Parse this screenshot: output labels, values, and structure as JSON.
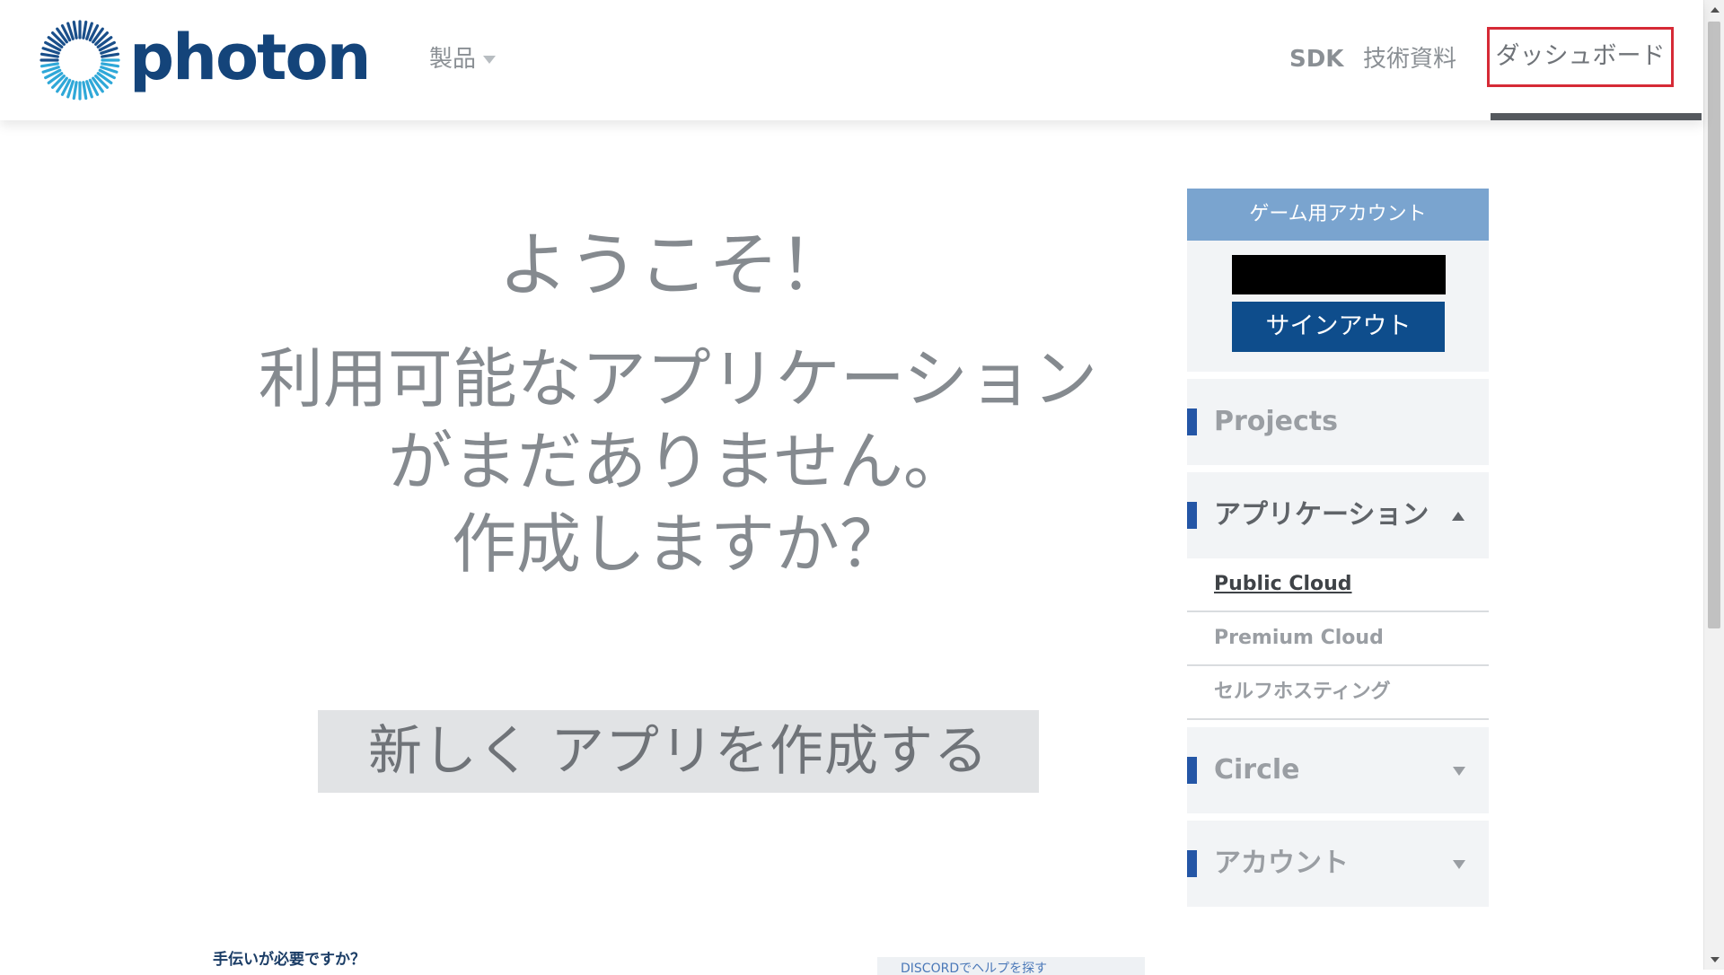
{
  "header": {
    "logo_text": "photon",
    "nav": {
      "products": "製品",
      "sdk": "SDK",
      "docs": "技術資料",
      "dashboard": "ダッシュボード"
    }
  },
  "main": {
    "welcome": "ようこそ！",
    "empty_message": {
      "line1": "利用可能なアプリケーション",
      "line2": "がまだありません。",
      "line3": "作成しますか？"
    },
    "create_button": "新しく アプリを作成する",
    "help_text": "手伝いが必要ですか？",
    "discord_text": "DISCORDでヘルプを探す"
  },
  "sidebar": {
    "account_header": "ゲーム用アカウント",
    "signout": "サインアウト",
    "menu": {
      "projects": "Projects",
      "applications": "アプリケーション",
      "submenu": {
        "public_cloud": "Public Cloud",
        "premium_cloud": "Premium Cloud",
        "self_hosting": "セルフホスティング"
      },
      "circle": "Circle",
      "account": "アカウント"
    }
  },
  "colors": {
    "brand": "#14447a",
    "accent_marker": "#2456a6",
    "signout_bg": "#0e4d8c",
    "account_header_bg": "#7aa4cf",
    "highlight_box": "#d62a36"
  }
}
